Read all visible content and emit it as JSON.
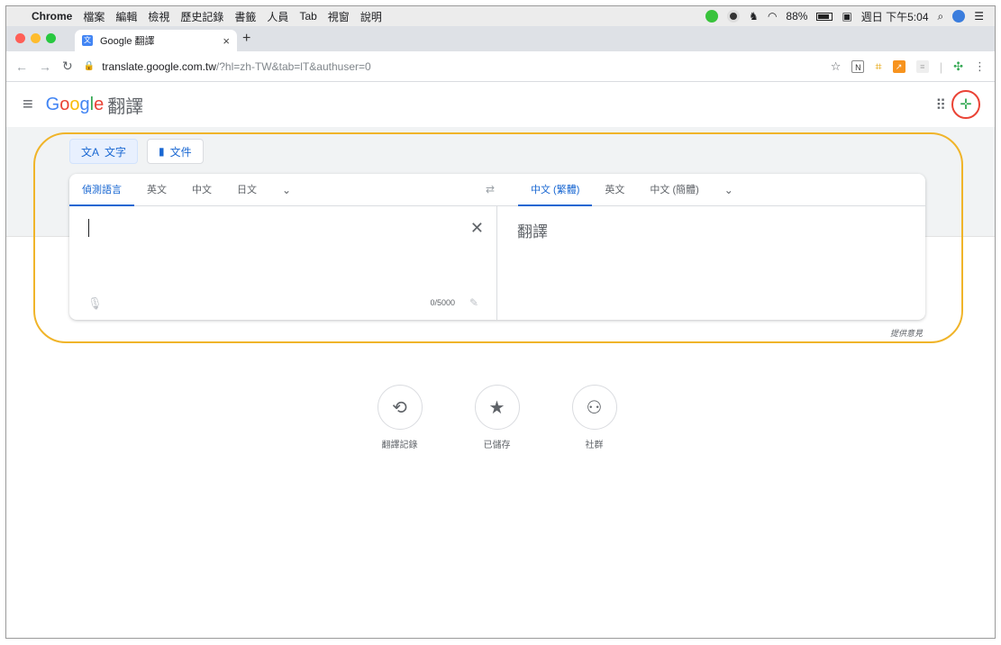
{
  "menubar": {
    "app_name": "Chrome",
    "items": [
      "檔案",
      "編輯",
      "檢視",
      "歷史記錄",
      "書籤",
      "人員",
      "Tab",
      "視窗",
      "說明"
    ],
    "battery": "88%",
    "clock": "週日 下午5:04"
  },
  "browser": {
    "tab_title": "Google 翻譯",
    "tab_close": "×",
    "new_tab": "+",
    "url_host": "translate.google.com.tw",
    "url_path": "/?hl=zh-TW&tab=lT&authuser=0"
  },
  "header": {
    "logo": [
      "G",
      "o",
      "o",
      "g",
      "l",
      "e"
    ],
    "suffix": "翻譯"
  },
  "modes": {
    "text": "文字",
    "document": "文件"
  },
  "source_langs": [
    "偵測語言",
    "英文",
    "中文",
    "日文"
  ],
  "target_langs": [
    "中文 (繁體)",
    "英文",
    "中文 (簡體)"
  ],
  "source": {
    "value": "",
    "char_count": "0/5000"
  },
  "target": {
    "placeholder": "翻譯"
  },
  "feedback": "提供意見",
  "actions": {
    "history": "翻譯記錄",
    "saved": "已儲存",
    "community": "社群"
  },
  "colors": {
    "accent": "#1967d2",
    "highlight": "#f0b429"
  }
}
